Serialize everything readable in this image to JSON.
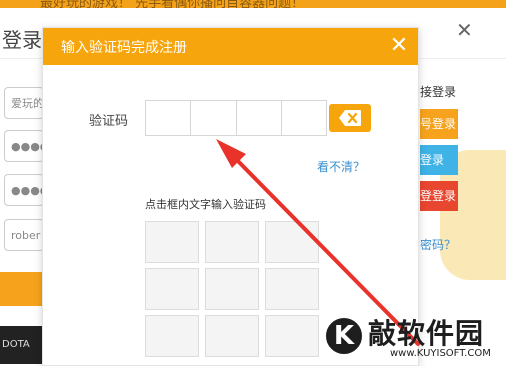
{
  "background": {
    "top_banner_text": "最好玩的游戏！ 先手看偶你播问目容器问题！",
    "window_title": "登录",
    "close_symbol": "✕",
    "fields": [
      {
        "value": "爱玩的"
      },
      {
        "value": "●●●●"
      },
      {
        "value": "●●●●"
      },
      {
        "value": "rober"
      }
    ],
    "dark_strip_text": "DOTA",
    "right_label": "接登录",
    "right_buttons": [
      {
        "label": "号登录",
        "color": "#f6a21d"
      },
      {
        "label": "登录",
        "color": "#3fb2e6"
      },
      {
        "label": "登登录",
        "color": "#e8462f"
      }
    ],
    "forgot_link": "密码？"
  },
  "modal": {
    "title": "输入验证码完成注册",
    "close_symbol": "✕",
    "code_label": "验证码",
    "code_slots": 4,
    "cant_see_link": "看不清？",
    "grid_hint": "点击框内文字输入验证码",
    "grid_cells": 9
  },
  "watermark": {
    "logo_letter": "K",
    "text": "敲软件园",
    "sub": "www.KUYISOFT.COM"
  },
  "colors": {
    "accent_orange": "#f6a50d",
    "link_blue": "#3a8fd0",
    "arrow_red": "#e8322a"
  }
}
